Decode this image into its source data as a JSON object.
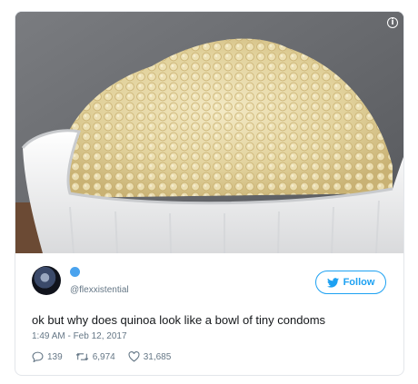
{
  "tweet": {
    "handle": "@flexxistential",
    "follow_label": "Follow",
    "text": "ok but why does quinoa look like a bowl of tiny condoms",
    "timestamp": "1:49 AM - Feb 12, 2017",
    "replies": "139",
    "retweets": "6,974",
    "likes": "31,685"
  },
  "colors": {
    "twitter_blue": "#1da1f2",
    "meta_gray": "#657786"
  },
  "icons": [
    "info-icon",
    "twitter-bird-icon",
    "reply-icon",
    "retweet-icon",
    "heart-icon"
  ]
}
